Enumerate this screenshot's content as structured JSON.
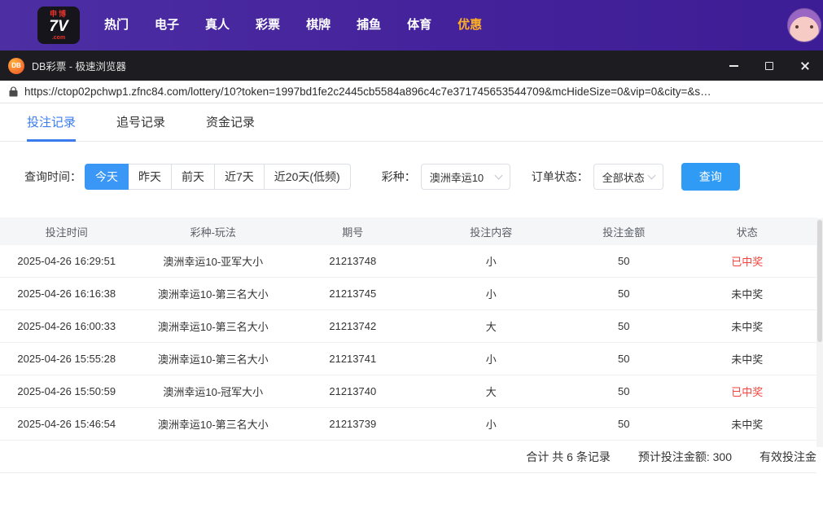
{
  "top_nav": {
    "logo": {
      "line1": "申博",
      "line2": "7V",
      "line3": ".com"
    },
    "items": [
      {
        "label": "热门",
        "highlight": false
      },
      {
        "label": "电子",
        "highlight": false
      },
      {
        "label": "真人",
        "highlight": false
      },
      {
        "label": "彩票",
        "highlight": false
      },
      {
        "label": "棋牌",
        "highlight": false
      },
      {
        "label": "捕鱼",
        "highlight": false
      },
      {
        "label": "体育",
        "highlight": false
      },
      {
        "label": "优惠",
        "highlight": true
      }
    ]
  },
  "browser": {
    "icon_text": "DB",
    "title": "DB彩票 - 极速浏览器",
    "url": "https://ctop02pchwp1.zfnc84.com/lottery/10?token=1997bd1fe2c2445cb5584a896c4c7e371745653544709&mcHideSize=0&vip=0&city=&s…"
  },
  "tabs": [
    {
      "label": "投注记录",
      "active": true
    },
    {
      "label": "追号记录",
      "active": false
    },
    {
      "label": "资金记录",
      "active": false
    }
  ],
  "filters": {
    "time_label": "查询时间：",
    "time_options": [
      {
        "label": "今天",
        "active": true
      },
      {
        "label": "昨天",
        "active": false
      },
      {
        "label": "前天",
        "active": false
      },
      {
        "label": "近7天",
        "active": false
      },
      {
        "label": "近20天(低频)",
        "active": false
      }
    ],
    "lottery_label": "彩种：",
    "lottery_value": "澳洲幸运10",
    "status_label": "订单状态：",
    "status_value": "全部状态",
    "query_button": "查询"
  },
  "table": {
    "headers": [
      "投注时间",
      "彩种-玩法",
      "期号",
      "投注内容",
      "投注金额",
      "状态"
    ],
    "rows": [
      {
        "time": "2025-04-26 16:29:51",
        "game": "澳洲幸运10-亚军大小",
        "issue": "21213748",
        "content": "小",
        "amount": "50",
        "status": "已中奖",
        "won": true
      },
      {
        "time": "2025-04-26 16:16:38",
        "game": "澳洲幸运10-第三名大小",
        "issue": "21213745",
        "content": "小",
        "amount": "50",
        "status": "未中奖",
        "won": false
      },
      {
        "time": "2025-04-26 16:00:33",
        "game": "澳洲幸运10-第三名大小",
        "issue": "21213742",
        "content": "大",
        "amount": "50",
        "status": "未中奖",
        "won": false
      },
      {
        "time": "2025-04-26 15:55:28",
        "game": "澳洲幸运10-第三名大小",
        "issue": "21213741",
        "content": "小",
        "amount": "50",
        "status": "未中奖",
        "won": false
      },
      {
        "time": "2025-04-26 15:50:59",
        "game": "澳洲幸运10-冠军大小",
        "issue": "21213740",
        "content": "大",
        "amount": "50",
        "status": "已中奖",
        "won": true
      },
      {
        "time": "2025-04-26 15:46:54",
        "game": "澳洲幸运10-第三名大小",
        "issue": "21213739",
        "content": "小",
        "amount": "50",
        "status": "未中奖",
        "won": false
      }
    ],
    "summary": {
      "total": "合计 共 6 条记录",
      "expected": "预计投注金额: 300",
      "valid": "有效投注金"
    }
  },
  "colors": {
    "accent_blue": "#2f9bf5",
    "tab_blue": "#3a7cf0",
    "win_red": "#f4433c",
    "nav_highlight": "#ffaf24",
    "nav_purple": "#44229b"
  }
}
